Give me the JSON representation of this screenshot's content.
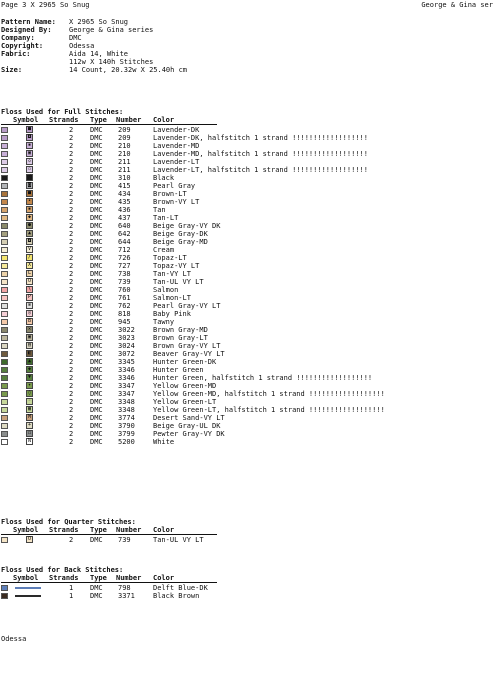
{
  "header": {
    "left": "Page 3  X 2965 So Snug",
    "right": "George & Gina ser"
  },
  "info": [
    {
      "label": "Pattern Name:",
      "value": "X 2965 So Snug"
    },
    {
      "label": "Designed By:",
      "value": "George & Gina series"
    },
    {
      "label": "Company:",
      "value": "DMC"
    },
    {
      "label": "Copyright:",
      "value": "Odessa"
    },
    {
      "label": "Fabric:",
      "value": "Aida 14, White"
    },
    {
      "label": "",
      "value": "112w X 140h Stitches"
    },
    {
      "label": "Size:",
      "value": "14 Count,   20.32w X 25.40h cm"
    }
  ],
  "columns": {
    "symbol": "Symbol",
    "strands": "Strands",
    "type": "Type",
    "number": "Number",
    "color": "Color"
  },
  "full": {
    "title": "Floss Used for Full Stitches:",
    "rows": [
      {
        "swatch": "#b89cc8",
        "symbol": "■",
        "strands": "2",
        "type": "DMC",
        "number": "209",
        "color": "Lavender-DK"
      },
      {
        "swatch": "#b89cc8",
        "symbol": "◘",
        "strands": "2",
        "type": "DMC",
        "number": "209",
        "color": "Lavender-DK, halfstitch 1 strand !!!!!!!!!!!!!!!!!!"
      },
      {
        "swatch": "#c9b0d8",
        "symbol": "▪",
        "strands": "2",
        "type": "DMC",
        "number": "210",
        "color": "Lavender-MD"
      },
      {
        "swatch": "#c9b0d8",
        "symbol": "▣",
        "strands": "2",
        "type": "DMC",
        "number": "210",
        "color": "Lavender-MD, halfstitch 1 strand !!!!!!!!!!!!!!!!!!"
      },
      {
        "swatch": "#dccbe6",
        "symbol": "◇",
        "strands": "2",
        "type": "DMC",
        "number": "211",
        "color": "Lavender-LT"
      },
      {
        "swatch": "#dccbe6",
        "symbol": "▫",
        "strands": "2",
        "type": "DMC",
        "number": "211",
        "color": "Lavender-LT, halfstitch 1 strand !!!!!!!!!!!!!!!!!!"
      },
      {
        "swatch": "#1a1a1a",
        "symbol": "/",
        "strands": "2",
        "type": "DMC",
        "number": "310",
        "color": "Black"
      },
      {
        "swatch": "#b4b6b9",
        "symbol": "◙",
        "strands": "2",
        "type": "DMC",
        "number": "415",
        "color": "Pearl Gray"
      },
      {
        "swatch": "#a9743b",
        "symbol": "■",
        "strands": "2",
        "type": "DMC",
        "number": "434",
        "color": "Brown-LT"
      },
      {
        "swatch": "#c3874b",
        "symbol": "•",
        "strands": "2",
        "type": "DMC",
        "number": "435",
        "color": "Brown-VY LT"
      },
      {
        "swatch": "#d6a36b",
        "symbol": "▪",
        "strands": "2",
        "type": "DMC",
        "number": "436",
        "color": "Tan"
      },
      {
        "swatch": "#e1b883",
        "symbol": "◆",
        "strands": "2",
        "type": "DMC",
        "number": "437",
        "color": "Tan-LT"
      },
      {
        "swatch": "#8a8a6a",
        "symbol": "●",
        "strands": "2",
        "type": "DMC",
        "number": "640",
        "color": "Beige Gray-VY DK"
      },
      {
        "swatch": "#a4a07f",
        "symbol": "▲",
        "strands": "2",
        "type": "DMC",
        "number": "642",
        "color": "Beige Gray-DK"
      },
      {
        "swatch": "#d3cdb2",
        "symbol": "◘",
        "strands": "2",
        "type": "DMC",
        "number": "644",
        "color": "Beige Gray-MD"
      },
      {
        "swatch": "#f3ecd3",
        "symbol": "V",
        "strands": "2",
        "type": "DMC",
        "number": "712",
        "color": "Cream"
      },
      {
        "swatch": "#f4e56f",
        "symbol": "/",
        "strands": "2",
        "type": "DMC",
        "number": "726",
        "color": "Topaz-LT"
      },
      {
        "swatch": "#f6ea9b",
        "symbol": "X",
        "strands": "2",
        "type": "DMC",
        "number": "727",
        "color": "Topaz-VY LT"
      },
      {
        "swatch": "#ecd2a9",
        "symbol": "L",
        "strands": "2",
        "type": "DMC",
        "number": "738",
        "color": "Tan-VY LT"
      },
      {
        "swatch": "#f4e4c6",
        "symbol": "O",
        "strands": "2",
        "type": "DMC",
        "number": "739",
        "color": "Tan-UL VY LT"
      },
      {
        "swatch": "#f2a4a4",
        "symbol": "\\",
        "strands": "2",
        "type": "DMC",
        "number": "760",
        "color": "Salmon"
      },
      {
        "swatch": "#f7c3c0",
        "symbol": "P",
        "strands": "2",
        "type": "DMC",
        "number": "761",
        "color": "Salmon-LT"
      },
      {
        "swatch": "#dfe0de",
        "symbol": "⊗",
        "strands": "2",
        "type": "DMC",
        "number": "762",
        "color": "Pearl Gray-VY LT"
      },
      {
        "swatch": "#f5cfd6",
        "symbol": "◎",
        "strands": "2",
        "type": "DMC",
        "number": "818",
        "color": "Baby Pink"
      },
      {
        "swatch": "#f4c9a9",
        "symbol": "B",
        "strands": "2",
        "type": "DMC",
        "number": "945",
        "color": "Tawny"
      },
      {
        "swatch": "#8a876c",
        "symbol": "✕",
        "strands": "2",
        "type": "DMC",
        "number": "3022",
        "color": "Brown Gray-MD"
      },
      {
        "swatch": "#bcb69d",
        "symbol": "▣",
        "strands": "2",
        "type": "DMC",
        "number": "3023",
        "color": "Brown Gray-LT"
      },
      {
        "swatch": "#dad6c2",
        "symbol": "▤",
        "strands": "2",
        "type": "DMC",
        "number": "3024",
        "color": "Brown Gray-VY LT"
      },
      {
        "swatch": "#6f5b3e",
        "symbol": "◧",
        "strands": "2",
        "type": "DMC",
        "number": "3072",
        "color": "Beaver Gray-VY LT"
      },
      {
        "swatch": "#3f6b2c",
        "symbol": "▲",
        "strands": "2",
        "type": "DMC",
        "number": "3345",
        "color": "Hunter Green-DK"
      },
      {
        "swatch": "#567f3d",
        "symbol": "◆",
        "strands": "2",
        "type": "DMC",
        "number": "3346",
        "color": "Hunter Green"
      },
      {
        "swatch": "#567f3d",
        "symbol": "▼",
        "strands": "2",
        "type": "DMC",
        "number": "3346",
        "color": "Hunter Green, halfstitch 1 strand !!!!!!!!!!!!!!!!!!"
      },
      {
        "swatch": "#7a9b4d",
        "symbol": "✦",
        "strands": "2",
        "type": "DMC",
        "number": "3347",
        "color": "Yellow Green-MD"
      },
      {
        "swatch": "#7a9b4d",
        "symbol": "◊",
        "strands": "2",
        "type": "DMC",
        "number": "3347",
        "color": "Yellow Green-MD, halfstitch 1 strand !!!!!!!!!!!!!!!!!!"
      },
      {
        "swatch": "#c6d79a",
        "symbol": "◦",
        "strands": "2",
        "type": "DMC",
        "number": "3348",
        "color": "Yellow Green-LT"
      },
      {
        "swatch": "#c6d79a",
        "symbol": "▦",
        "strands": "2",
        "type": "DMC",
        "number": "3348",
        "color": "Yellow Green-LT, halfstitch 1 strand !!!!!!!!!!!!!!!!!!"
      },
      {
        "swatch": "#c7a07c",
        "symbol": "M",
        "strands": "2",
        "type": "DMC",
        "number": "3774",
        "color": "Desert Sand-VY LT"
      },
      {
        "swatch": "#dedbc3",
        "symbol": "+",
        "strands": "2",
        "type": "DMC",
        "number": "3790",
        "color": "Beige Gray-UL DK"
      },
      {
        "swatch": "#8b8e8d",
        "symbol": "◻",
        "strands": "2",
        "type": "DMC",
        "number": "3799",
        "color": "Pewter Gray-VY DK"
      },
      {
        "swatch": "#ffffff",
        "symbol": "N",
        "strands": "2",
        "type": "DMC",
        "number": "5200",
        "color": "White"
      }
    ]
  },
  "quarter": {
    "title": "Floss Used for Quarter Stitches:",
    "rows": [
      {
        "swatch": "#f4e4c6",
        "symbol": "O",
        "strands": "2",
        "type": "DMC",
        "number": "739",
        "color": "Tan-UL VY LT"
      }
    ]
  },
  "back": {
    "title": "Floss Used for Back Stitches:",
    "rows": [
      {
        "swatch": "#5e7fb9",
        "line": "#5e7fb9",
        "strands": "1",
        "type": "DMC",
        "number": "798",
        "color": "Delft Blue-DK"
      },
      {
        "swatch": "#3a2a1f",
        "line": "#2a2a2a",
        "strands": "1",
        "type": "DMC",
        "number": "3371",
        "color": "Black Brown"
      }
    ]
  },
  "footer": "Odessa"
}
